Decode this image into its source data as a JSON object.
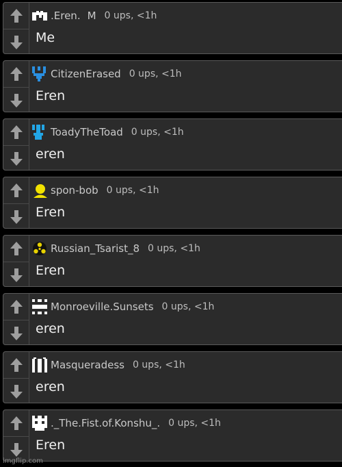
{
  "comments": [
    {
      "username": ".Eren.",
      "flair": "M",
      "stats": "0 ups, <1h",
      "text": "Me",
      "avatar": "pixel-invader-icon",
      "avatar_color": "#ffffff"
    },
    {
      "username": "CitizenErased",
      "flair": "",
      "stats": "0 ups, <1h",
      "text": "Eren",
      "avatar": "pixel-fork-icon",
      "avatar_color": "#2a8fe0"
    },
    {
      "username": "ToadyTheToad",
      "flair": "",
      "stats": "0 ups, <1h",
      "text": "eren",
      "avatar": "pixel-plant-icon",
      "avatar_color": "#22a6e6"
    },
    {
      "username": "spon-bob",
      "flair": "",
      "stats": "0 ups, <1h",
      "text": "Eren",
      "avatar": "person-silhouette-icon",
      "avatar_color": "#f2e200"
    },
    {
      "username": "Russian_Tsarist_8",
      "flair": "",
      "stats": "0 ups, <1h",
      "text": "Eren",
      "avatar": "radiation-icon",
      "avatar_color": "#e6d000"
    },
    {
      "username": "Monroeville.Sunsets",
      "flair": "",
      "stats": "0 ups, <1h",
      "text": "eren",
      "avatar": "pixel-cross-icon",
      "avatar_color": "#ffffff"
    },
    {
      "username": "Masqueradess",
      "flair": "",
      "stats": "0 ups, <1h",
      "text": "eren",
      "avatar": "pixel-columns-icon",
      "avatar_color": "#ffffff"
    },
    {
      "username": "._The.Fist.of.Konshu_.",
      "flair": "",
      "stats": "0 ups, <1h",
      "text": "Eren",
      "avatar": "pixel-robot-icon",
      "avatar_color": "#ffffff"
    }
  ],
  "watermark": "imgflip.com",
  "colors": {
    "background": "#000000",
    "card": "#2b2b2b",
    "border": "#5a5a5a",
    "arrow": "#9e9e9e"
  }
}
